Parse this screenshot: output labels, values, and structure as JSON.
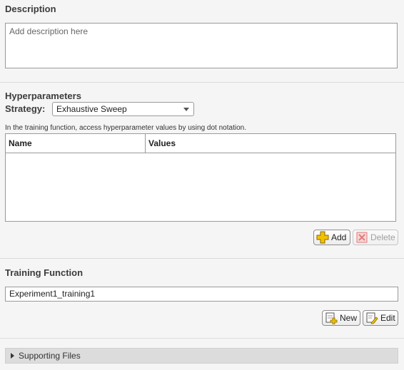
{
  "description": {
    "title": "Description",
    "placeholder": "Add description here"
  },
  "hyperparameters": {
    "title": "Hyperparameters",
    "strategy_label": "Strategy:",
    "strategy_value": "Exhaustive Sweep",
    "hint": "In the training function, access hyperparameter values by using dot notation.",
    "columns": [
      "Name",
      "Values"
    ],
    "rows": [],
    "add_label": "Add",
    "delete_label": "Delete"
  },
  "training_function": {
    "title": "Training Function",
    "value": "Experiment1_training1",
    "new_label": "New",
    "edit_label": "Edit"
  },
  "supporting_files": {
    "title": "Supporting Files",
    "expanded": false
  },
  "icons": {
    "add": "plus-icon",
    "delete": "delete-x-icon",
    "new": "new-file-icon",
    "edit": "edit-pencil-icon",
    "expand": "triangle-right-icon",
    "dropdown": "chevron-down-icon"
  },
  "colors": {
    "background": "#f5f5f5",
    "plus_icon": "#f2c200",
    "delete_icon": "#e27a7a"
  }
}
